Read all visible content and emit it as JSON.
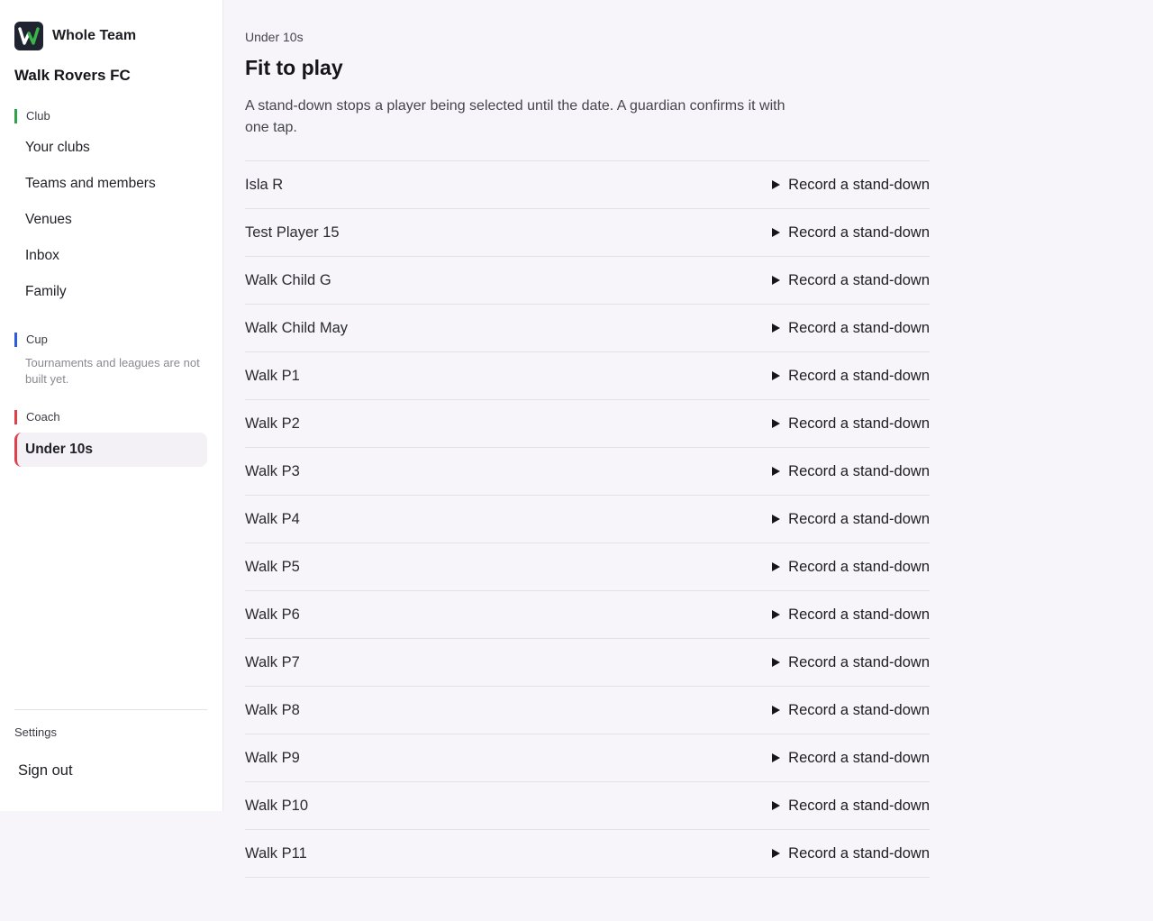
{
  "sidebar": {
    "brand_name": "Whole Team",
    "club_name": "Walk Rovers FC",
    "sections": {
      "club": {
        "label": "Club",
        "color": "#2fa34a"
      },
      "cup": {
        "label": "Cup",
        "color": "#2d5be3",
        "note": "Tournaments and leagues are not built yet."
      },
      "coach": {
        "label": "Coach",
        "color": "#e0404a"
      }
    },
    "club_items": [
      "Your clubs",
      "Teams and members",
      "Venues",
      "Inbox",
      "Family"
    ],
    "coach_items": [
      "Under 10s"
    ],
    "settings_label": "Settings",
    "signout_label": "Sign out"
  },
  "main": {
    "breadcrumb": "Under 10s",
    "title": "Fit to play",
    "intro": "A stand-down stops a player being selected until the date. A guardian confirms it with one tap.",
    "action_label": "Record a stand-down",
    "players": [
      "Isla R",
      "Test Player 15",
      "Walk Child G",
      "Walk Child May",
      "Walk P1",
      "Walk P2",
      "Walk P3",
      "Walk P4",
      "Walk P5",
      "Walk P6",
      "Walk P7",
      "Walk P8",
      "Walk P9",
      "Walk P10",
      "Walk P11"
    ]
  }
}
